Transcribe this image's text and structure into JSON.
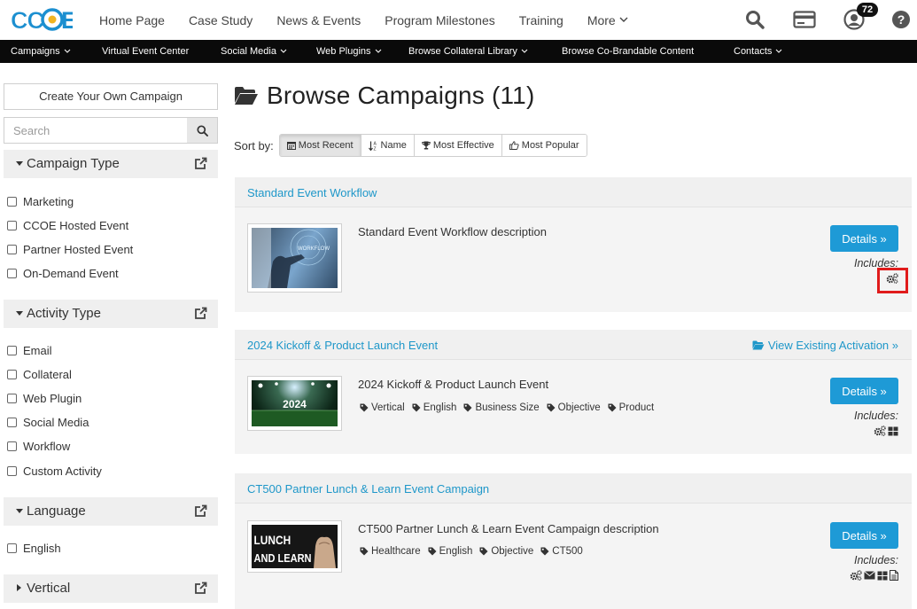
{
  "top_nav": {
    "logo_text": "CCOE",
    "links": [
      "Home Page",
      "Case Study",
      "News & Events",
      "Program Milestones",
      "Training",
      "More"
    ],
    "notification_count": "72",
    "icons": [
      "search-icon",
      "card-icon",
      "user-icon",
      "help-icon"
    ]
  },
  "sub_nav": {
    "items": [
      "Campaigns",
      "Virtual Event Center",
      "Social Media",
      "Web Plugins",
      "Browse Collateral Library",
      "Browse Co-Brandable Content",
      "Contacts"
    ]
  },
  "sidebar": {
    "create_button": "Create Your Own Campaign",
    "search_placeholder": "Search",
    "facets": [
      {
        "title": "Campaign Type",
        "options": [
          "Marketing",
          "CCOE Hosted Event",
          "Partner Hosted Event",
          "On-Demand Event"
        ]
      },
      {
        "title": "Activity Type",
        "options": [
          "Email",
          "Collateral",
          "Web Plugin",
          "Social Media",
          "Workflow",
          "Custom Activity"
        ]
      },
      {
        "title": "Language",
        "options": [
          "English"
        ]
      },
      {
        "title": "Vertical",
        "options": []
      }
    ]
  },
  "main": {
    "title": "Browse Campaigns (11)",
    "sort_label": "Sort by:",
    "sort_options": [
      "Most Recent",
      "Name",
      "Most Effective",
      "Most Popular"
    ],
    "sort_active": "Most Recent"
  },
  "campaigns": [
    {
      "title": "Standard Event Workflow",
      "description": "Standard Event Workflow description",
      "tags": [],
      "link": "",
      "thumb_text": "WORKFLOW",
      "details_label": "Details »",
      "includes_label": "Includes:",
      "includes_icons": [
        "workflow-icon"
      ]
    },
    {
      "title": "2024 Kickoff & Product Launch Event",
      "description": "2024 Kickoff & Product Launch Event",
      "tags": [
        "Vertical",
        "English",
        "Business Size",
        "Objective",
        "Product"
      ],
      "link": "View Existing Activation »",
      "thumb_text": "2024",
      "details_label": "Details »",
      "includes_label": "Includes:",
      "includes_icons": [
        "workflow-icon",
        "web-plugin-icon"
      ]
    },
    {
      "title": "CT500 Partner Lunch & Learn Event Campaign",
      "description": "CT500 Partner Lunch & Learn Event Campaign description",
      "tags": [
        "Healthcare",
        "English",
        "Objective",
        "CT500"
      ],
      "link": "",
      "thumb_text": "LUNCH AND LEARN",
      "details_label": "Details »",
      "includes_label": "Includes:",
      "includes_icons": [
        "workflow-icon",
        "email-icon",
        "web-plugin-icon",
        "collateral-icon"
      ]
    }
  ],
  "colors": {
    "accent": "#1e9ad6",
    "link": "#1e97c9",
    "subnav_bg": "#0a0a0a",
    "highlight": "#e01b1b"
  }
}
